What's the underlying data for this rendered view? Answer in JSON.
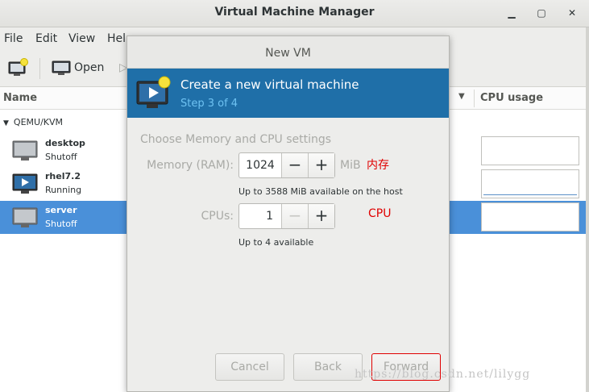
{
  "window": {
    "title": "Virtual Machine Manager",
    "minimize": "▁",
    "maximize": "▢",
    "close": "✕"
  },
  "menubar": [
    "File",
    "Edit",
    "View",
    "Help"
  ],
  "toolbar": {
    "open_label": "Open"
  },
  "columns": {
    "name": "Name",
    "cpu_usage": "CPU usage"
  },
  "group": {
    "name": "QEMU/KVM"
  },
  "vms": [
    {
      "name": "desktop",
      "state": "Shutoff",
      "icon": "monitor-off-icon"
    },
    {
      "name": "rhel7.2",
      "state": "Running",
      "icon": "monitor-running-icon"
    },
    {
      "name": "server",
      "state": "Shutoff",
      "icon": "monitor-off-icon",
      "selected": true
    }
  ],
  "dialog": {
    "title": "New VM",
    "banner_title": "Create a new virtual machine",
    "banner_step": "Step 3 of 4",
    "section": "Choose Memory and CPU settings",
    "memory_label": "Memory (RAM):",
    "memory_value": "1024",
    "memory_unit": "MiB",
    "memory_hint": "Up to 3588 MiB available on the host",
    "cpus_label": "CPUs:",
    "cpus_value": "1",
    "cpus_hint": "Up to 4 available",
    "minus": "−",
    "plus": "+",
    "cancel": "Cancel",
    "back": "Back",
    "forward": "Forward"
  },
  "annotations": {
    "memory": "内存",
    "cpu": "CPU"
  },
  "watermark": "https://blog.csdn.net/lilygg",
  "colors": {
    "banner": "#1f6fa8",
    "selection": "#4a90d9",
    "annotation": "#e00000"
  }
}
